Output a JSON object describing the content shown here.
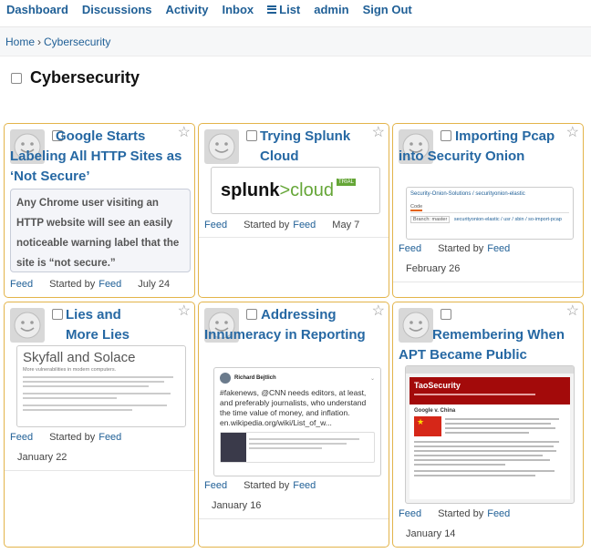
{
  "nav": {
    "dashboard": "Dashboard",
    "discussions": "Discussions",
    "activity": "Activity",
    "inbox": "Inbox",
    "list": "List",
    "admin": "admin",
    "signout": "Sign Out"
  },
  "breadcrumb": {
    "home": "Home",
    "separator": "›",
    "current": "Cybersecurity"
  },
  "page": {
    "title": "Cybersecurity"
  },
  "meta_labels": {
    "feed": "Feed",
    "started_by": "Started by",
    "started_by_link": "Feed"
  },
  "cards": [
    {
      "title": "Google Starts Labeling All HTTP Sites as ‘Not Secure’",
      "snippet": "Any Chrome user visiting an HTTP website will see an easily noticeable warning label that the site is “not secure.”",
      "date": "July 24"
    },
    {
      "title": "Trying Splunk Cloud",
      "thumb": {
        "logo_left": "splunk",
        "logo_right": ">cloud",
        "badge": "TRIAL"
      },
      "date": "May 7"
    },
    {
      "title": "Importing Pcap into Security Onion",
      "thumb": {
        "repo": "Security-Onion-Solutions / securityonion-elastic",
        "path": "securityonion-elastic / usr / sbin / so-import-pcap",
        "tab": "Code",
        "branch": "Branch: master"
      },
      "date": "February 26"
    },
    {
      "title": "Lies and More Lies",
      "thumb": {
        "heading": "Skyfall and Solace",
        "subheading": "More vulnerabilities in modern computers."
      },
      "date": "January 22"
    },
    {
      "title": "Addressing Innumeracy in Reporting",
      "thumb": {
        "author": "Richard Bejtlich",
        "text": "#fakenews, @CNN needs editors, at least, and preferably journalists, who understand the time value of money, and inflation. en.wikipedia.org/wiki/List_of_w..."
      },
      "date": "January 16"
    },
    {
      "title": "Remembering When APT Became Public",
      "thumb": {
        "blog_title": "TaoSecurity",
        "post_title": "Google v. China"
      },
      "date": "January 14"
    }
  ],
  "colors": {
    "accent": "#1f5f96",
    "title": "#2668a3",
    "card_border": "#e3b44a",
    "splunk_green": "#65a637",
    "tao_red": "#a30a0a"
  }
}
